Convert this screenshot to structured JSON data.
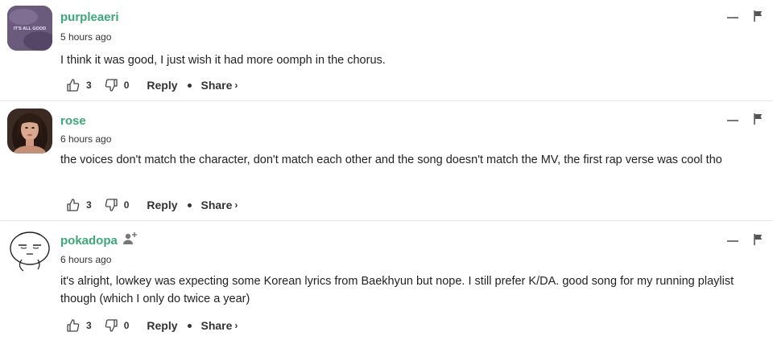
{
  "comments": [
    {
      "username": "purpleaeri",
      "timestamp": "5 hours ago",
      "text": "I think it was good, I just wish it had more oomph in the chorus.",
      "avatar_text": "IT'S ALL GOOD",
      "likes": "3",
      "dislikes": "0",
      "reply_label": "Reply",
      "share_label": "Share",
      "share_chevron": "›"
    },
    {
      "username": "rose",
      "timestamp": "6 hours ago",
      "text": "the voices don't match the character, don't match each other and the song doesn't match the MV, the first rap verse was cool tho",
      "likes": "3",
      "dislikes": "0",
      "reply_label": "Reply",
      "share_label": "Share",
      "share_chevron": "›"
    },
    {
      "username": "pokadopa",
      "timestamp": "6 hours ago",
      "text": "it's alright, lowkey was expecting some Korean lyrics from Baekhyun but nope. I still prefer K/DA. good song for my running playlist though (which I only do twice a year)",
      "likes": "3",
      "dislikes": "0",
      "reply_label": "Reply",
      "share_label": "Share",
      "share_chevron": "›"
    }
  ],
  "colors": {
    "username": "#3aa978",
    "text": "#222222",
    "icon": "#777777",
    "divider": "#e4e4e4"
  },
  "icons": {
    "like": "thumbs-up-icon",
    "dislike": "thumbs-down-icon",
    "collapse": "minus-icon",
    "report": "flag-icon",
    "follow": "add-user-icon"
  }
}
